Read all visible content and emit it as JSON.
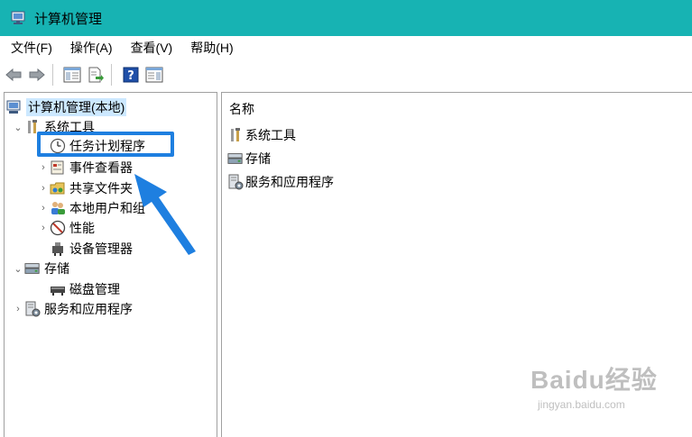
{
  "window": {
    "title": "计算机管理"
  },
  "menu": [
    "文件(F)",
    "操作(A)",
    "查看(V)",
    "帮助(H)"
  ],
  "toolbar": {
    "buttons": [
      "back-icon",
      "forward-icon",
      "show-hide-tree-icon",
      "export-list-icon",
      "help-icon",
      "show-action-pane-icon"
    ]
  },
  "tree": {
    "root": "计算机管理(本地)",
    "system_tools": "系统工具",
    "task_scheduler": "任务计划程序",
    "event_viewer": "事件查看器",
    "shared_folders": "共享文件夹",
    "local_users": "本地用户和组",
    "performance": "性能",
    "device_manager": "设备管理器",
    "storage": "存储",
    "disk_management": "磁盘管理",
    "services_apps": "服务和应用程序"
  },
  "list": {
    "header": "名称",
    "items": [
      "系统工具",
      "存储",
      "服务和应用程序"
    ]
  },
  "annotation": {
    "color": "#1e7fe0"
  },
  "watermark": {
    "brand": "Baidu经验",
    "url": "jingyan.baidu.com"
  },
  "colors": {
    "titlebar": "#17b3b3",
    "selection": "#cce8ff"
  }
}
